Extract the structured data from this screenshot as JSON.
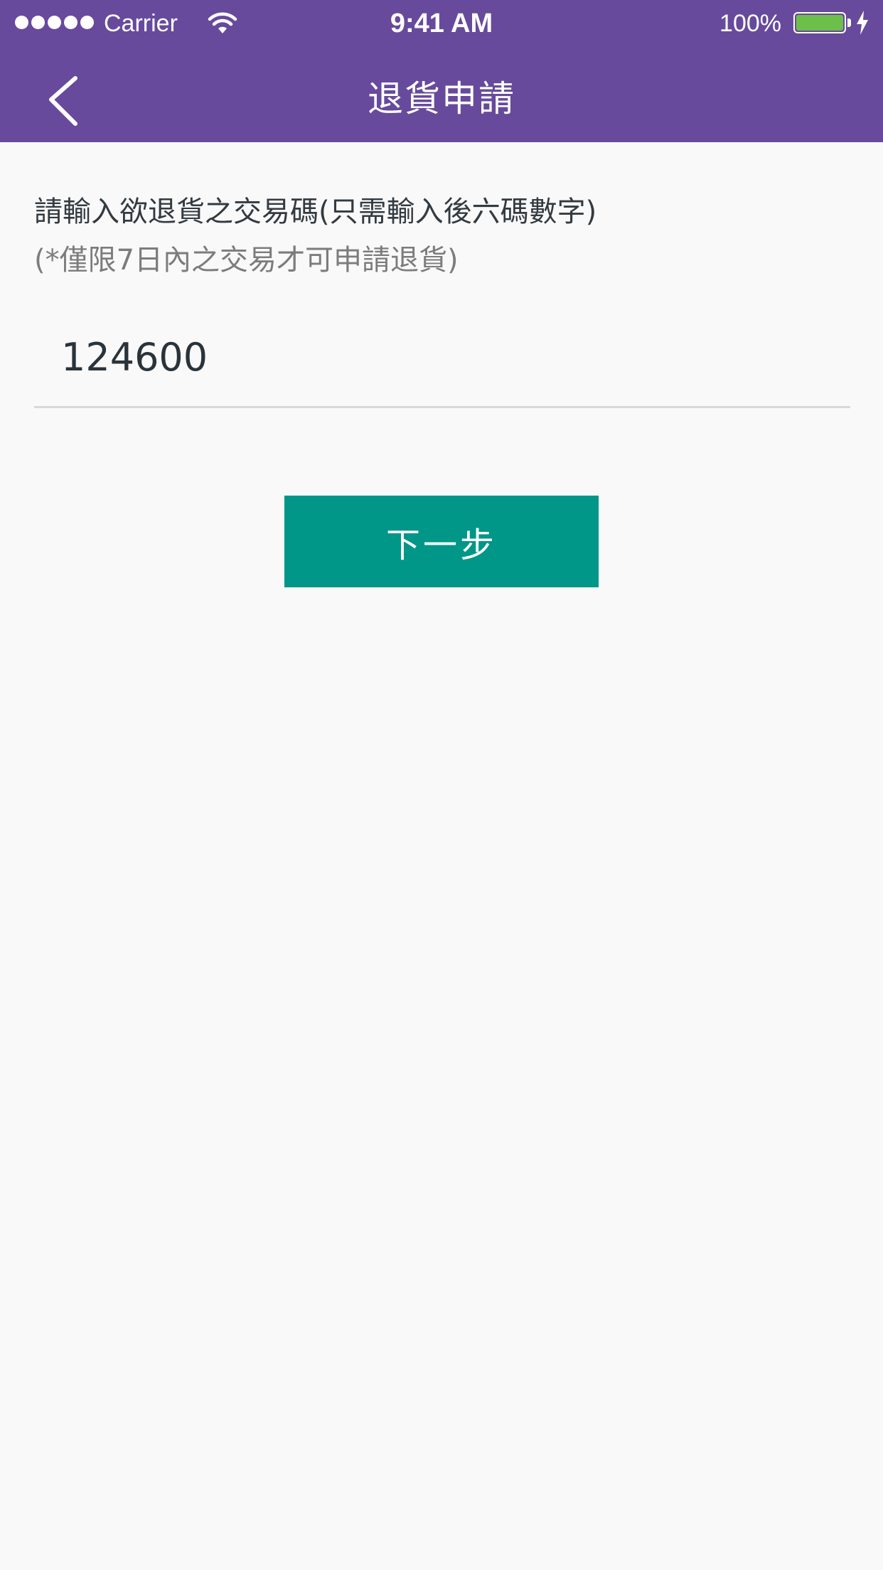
{
  "status_bar": {
    "carrier": "Carrier",
    "time": "9:41 AM",
    "battery": "100%",
    "icons": [
      "signal-dots-icon",
      "wifi-icon",
      "battery-icon",
      "charging-bolt-icon"
    ]
  },
  "nav": {
    "title": "退貨申請",
    "back_icon": "chevron-left-icon"
  },
  "form": {
    "instruction": "請輸入欲退貨之交易碼(只需輸入後六碼數字)",
    "note": "(*僅限7日內之交易才可申請退貨)",
    "code_value": "124600"
  },
  "actions": {
    "next_label": "下一步"
  },
  "colors": {
    "nav_bg": "#674a9c",
    "button_bg": "#009688",
    "page_bg": "#f9f9f9",
    "battery_fill": "#6cc04a"
  }
}
